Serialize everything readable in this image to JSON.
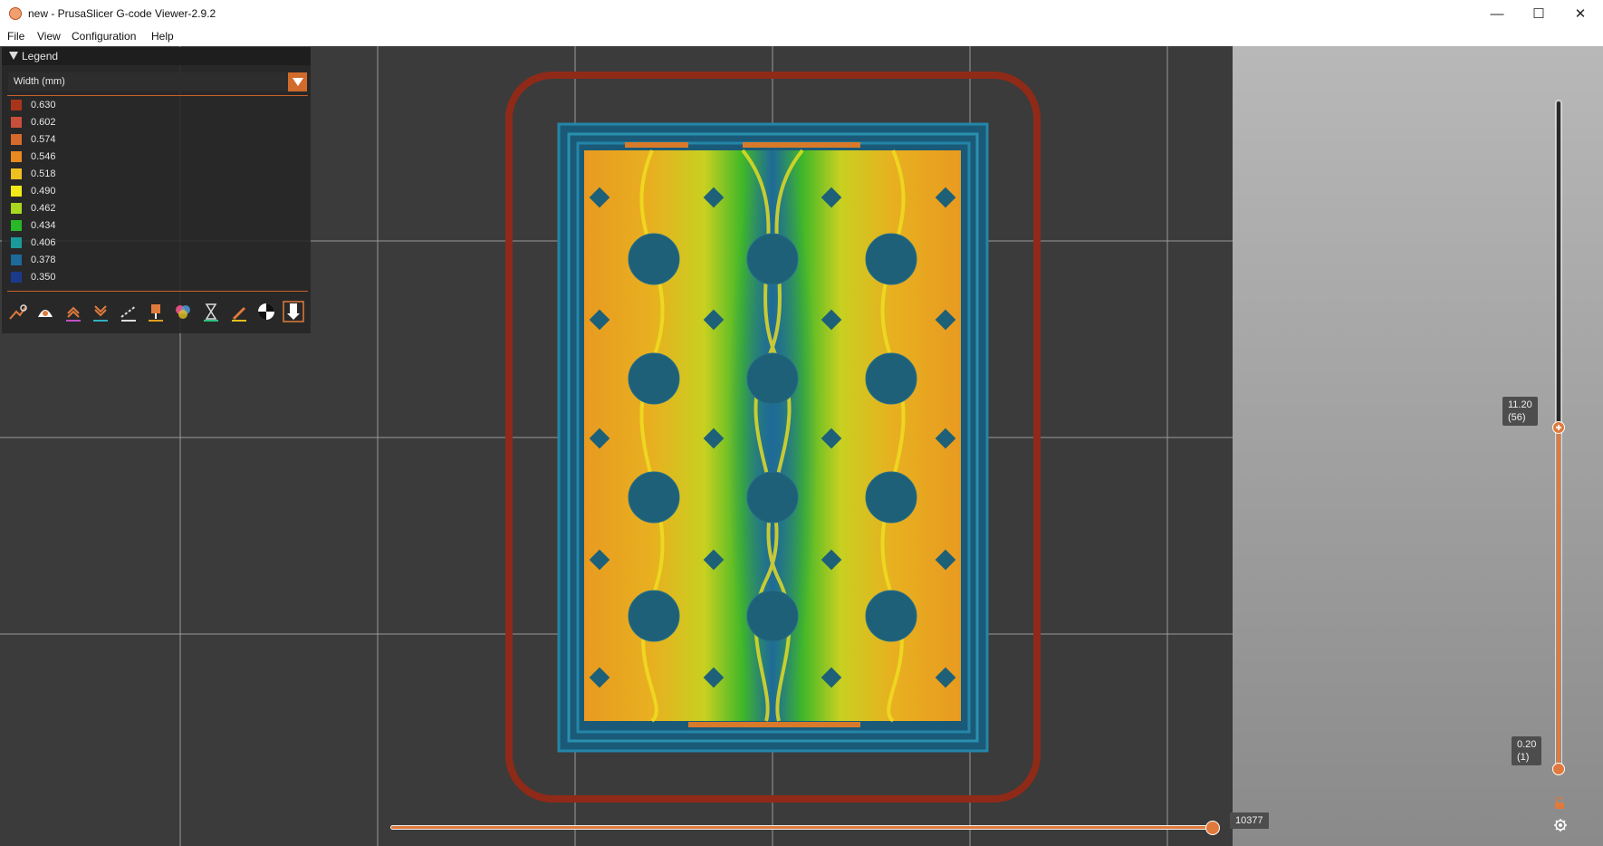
{
  "window": {
    "title": "new - PrusaSlicer G-code Viewer-2.9.2",
    "minimize": "—",
    "maximize": "☐",
    "close": "✕"
  },
  "menu": [
    "File",
    "View",
    "Configuration",
    "Help"
  ],
  "legend": {
    "title": "Legend",
    "view_type": "Width (mm)",
    "items": [
      {
        "value": "0.630",
        "color": "#a8341c"
      },
      {
        "value": "0.602",
        "color": "#c8503a"
      },
      {
        "value": "0.574",
        "color": "#d66a2e"
      },
      {
        "value": "0.546",
        "color": "#e88a20"
      },
      {
        "value": "0.518",
        "color": "#f0c020"
      },
      {
        "value": "0.490",
        "color": "#f4e818"
      },
      {
        "value": "0.462",
        "color": "#a8d820"
      },
      {
        "value": "0.434",
        "color": "#28b828"
      },
      {
        "value": "0.406",
        "color": "#1a9a98"
      },
      {
        "value": "0.378",
        "color": "#1e6a98"
      },
      {
        "value": "0.350",
        "color": "#1a3a8c"
      }
    ],
    "toolbar_icons": [
      "travel-icon",
      "wipe-icon",
      "retractions-icon",
      "deretractions-icon",
      "seams-icon",
      "tool-changes-icon",
      "color-changes-icon",
      "pause-prints-icon",
      "custom-gcodes-icon",
      "center-of-gravity-icon",
      "shells-icon"
    ]
  },
  "vertical_slider": {
    "top_label": "11.20\n(56)",
    "top_value": "11.20",
    "top_layer": "(56)",
    "bottom_value": "0.20",
    "bottom_layer": "(1)"
  },
  "horizontal_slider": {
    "value": "10377"
  },
  "colors": {
    "accent": "#e07a3c",
    "skirt": "#8f2a18",
    "perimeter": "#1f6e8e"
  }
}
